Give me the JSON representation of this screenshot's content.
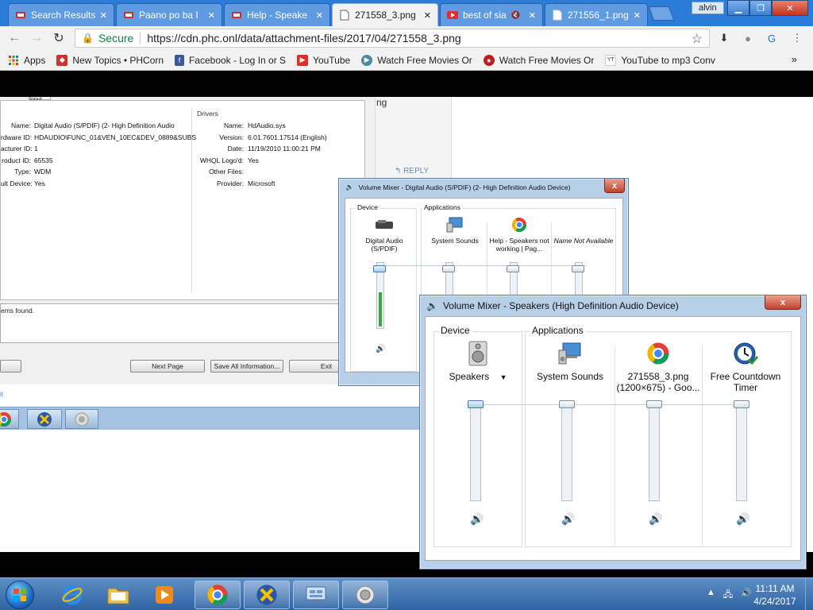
{
  "browser": {
    "tabs": [
      {
        "label": "Search Results",
        "icon": "site-icon"
      },
      {
        "label": "Paano po ba I",
        "icon": "site-icon"
      },
      {
        "label": "Help - Speake",
        "icon": "site-icon"
      },
      {
        "label": "271558_3.png",
        "icon": "document-icon",
        "active": true
      },
      {
        "label": "best of sia",
        "icon": "youtube-icon",
        "muted": true
      },
      {
        "label": "271556_1.png",
        "icon": "document-icon"
      }
    ],
    "user": "alvin",
    "secure_label": "Secure",
    "url": "https://cdn.phc.onl/data/attachment-files/2017/04/271558_3.png",
    "bookmarks": [
      {
        "label": "Apps",
        "icon": "apps-grid-icon"
      },
      {
        "label": "New Topics • PHCorn",
        "icon": "site-icon"
      },
      {
        "label": "Facebook - Log In or S",
        "icon": "facebook-icon"
      },
      {
        "label": "YouTube",
        "icon": "youtube-icon"
      },
      {
        "label": "Watch Free Movies Or",
        "icon": "play-circle-icon"
      },
      {
        "label": "Watch Free Movies Or",
        "icon": "movie-site-icon"
      },
      {
        "label": "YouTube to mp3 Conv",
        "icon": "yt-mp3-icon"
      }
    ],
    "bookmarks_more": "»"
  },
  "background_page": {
    "fragment_ng": "ng",
    "reply_label": "REPLY"
  },
  "properties_dialog": {
    "tab_label": "Input",
    "left": [
      {
        "key": "Name:",
        "value": "Digital Audio (S/PDIF) (2- High Definition Audio"
      },
      {
        "key": "rdware ID:",
        "value": "HDAUDIO\\FUNC_01&VEN_10EC&DEV_0889&SUBS"
      },
      {
        "key": "acturer ID:",
        "value": "1"
      },
      {
        "key": "roduct ID:",
        "value": "65535"
      },
      {
        "key": "Type:",
        "value": "WDM"
      },
      {
        "key": "ult Device:",
        "value": "Yes"
      }
    ],
    "drivers_title": "Drivers",
    "drivers": [
      {
        "key": "Name:",
        "value": "HdAudio.sys"
      },
      {
        "key": "Version:",
        "value": "6.01.7601.17514 (English)"
      },
      {
        "key": "Date:",
        "value": "11/19/2010 11:00:21 PM"
      },
      {
        "key": "WHQL Logo'd:",
        "value": "Yes"
      },
      {
        "key": "Other Files:",
        "value": ""
      },
      {
        "key": "Provider:",
        "value": "Microsoft"
      }
    ],
    "items_found": "ems found.",
    "buttons": {
      "next_page": "Next Page",
      "save_all": "Save All Information...",
      "exit": "Exit"
    },
    "link_fragment": "it"
  },
  "mixer_back": {
    "title": "Volume Mixer - Digital Audio (S/PDIF) (2- High Definition Audio Device)",
    "device_label": "Device",
    "applications_label": "Applications",
    "device": {
      "name": "Digital Audio (S/PDIF)",
      "level": 0.95,
      "meter": 0.55
    },
    "apps": [
      {
        "name": "System Sounds",
        "level": 0.95
      },
      {
        "name": "Help - Speakers not working | Pag...",
        "level": 0.95
      },
      {
        "name": "Name Not Available",
        "level": 0.95
      }
    ],
    "close": "x"
  },
  "mixer_front": {
    "title": "Volume Mixer - Speakers (High Definition Audio Device)",
    "device_label": "Device",
    "applications_label": "Applications",
    "device": {
      "name": "Speakers",
      "level": 1.0
    },
    "apps": [
      {
        "name": "System Sounds",
        "level": 1.0
      },
      {
        "name": "271558_3.png (1200×675) - Goo...",
        "level": 1.0
      },
      {
        "name": "Free Countdown Timer",
        "level": 1.0
      }
    ],
    "close": "x"
  },
  "taskbar": {
    "time": "11:11 AM",
    "date": "4/24/2017",
    "tray": [
      "▲",
      "🖧",
      "🔊"
    ]
  },
  "colors": {
    "taskbar": "#2f63a3",
    "accent": "#2b7bd9",
    "meter": "#3ca344"
  }
}
